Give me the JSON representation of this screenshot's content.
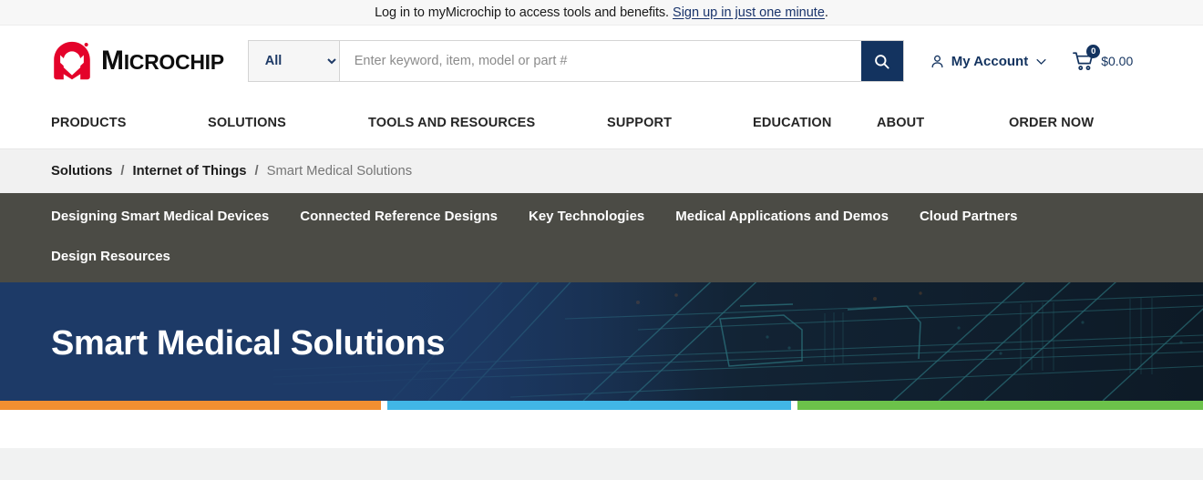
{
  "topbar": {
    "message": "Log in to myMicrochip to access tools and benefits.",
    "link_text": "Sign up in just one minute",
    "trailing": "."
  },
  "header": {
    "logo_text_prefix": "M",
    "logo_text_rest": "ICROCHIP",
    "search": {
      "selected_scope": "All",
      "scope_options": [
        "All"
      ],
      "placeholder": "Enter keyword, item, model or part #",
      "value": ""
    },
    "account_label": "My Account",
    "cart_count": "0",
    "cart_total": "$0.00"
  },
  "mainnav": {
    "items": [
      {
        "label": "PRODUCTS"
      },
      {
        "label": "SOLUTIONS"
      },
      {
        "label": "TOOLS AND RESOURCES"
      },
      {
        "label": "SUPPORT"
      },
      {
        "label": "EDUCATION"
      },
      {
        "label": "ABOUT"
      },
      {
        "label": "ORDER NOW"
      }
    ]
  },
  "breadcrumb": {
    "items": [
      {
        "label": "Solutions"
      },
      {
        "label": "Internet of Things"
      },
      {
        "label": "Smart Medical Solutions"
      }
    ],
    "separator": "/"
  },
  "subnav": {
    "items": [
      {
        "label": "Designing Smart Medical Devices"
      },
      {
        "label": "Connected Reference Designs"
      },
      {
        "label": "Key Technologies"
      },
      {
        "label": "Medical Applications and Demos"
      },
      {
        "label": "Cloud Partners"
      },
      {
        "label": "Design Resources"
      }
    ]
  },
  "hero": {
    "title": "Smart Medical Solutions"
  },
  "colors": {
    "brand_red": "#e4022a",
    "navy": "#13335f",
    "hero_navy": "#1d3a67",
    "subnav_gray": "#4b4b45",
    "stripe_orange": "#f18f31",
    "stripe_blue": "#41b6e6",
    "stripe_green": "#6cc24a",
    "breadcrumb_bg": "#f1f1f1",
    "topbar_bg": "#f7f7f7"
  }
}
